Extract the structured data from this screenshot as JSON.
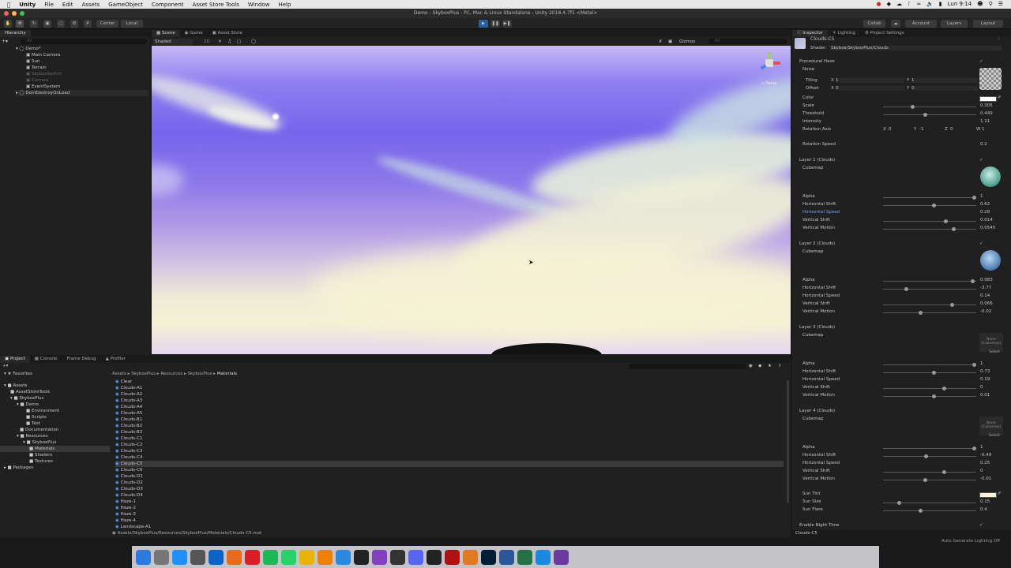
{
  "menubar": {
    "app": "Unity",
    "items": [
      "File",
      "Edit",
      "Assets",
      "GameObject",
      "Component",
      "Asset Store Tools",
      "Window",
      "Help"
    ],
    "clock": "Lun 9:14"
  },
  "window_title": "Demo - SkyboxPlus - PC, Mac & Linux Standalone - Unity 2018.4.7f1 <Metal>",
  "toolbar": {
    "center": "Center",
    "local": "Local",
    "collab": "Collab",
    "account": "Account",
    "layers": "Layers",
    "layout": "Layout"
  },
  "hierarchy": {
    "tab": "Hierarchy",
    "search_placeholder": "All",
    "scene_name": "Demo*",
    "items": [
      "Main Camera",
      "Sun",
      "Terrain",
      "SkyboxSwitch",
      "Camera",
      "EventSystem"
    ],
    "dont_destroy": "DontDestroyOnLoad"
  },
  "scene_view": {
    "tabs": [
      "Scene",
      "Game",
      "Asset Store"
    ],
    "shading": "Shaded",
    "mode": "2D",
    "gizmos": "Gizmos",
    "search_placeholder": "All",
    "persp": "< Persp"
  },
  "project": {
    "tabs": [
      "Project",
      "Console",
      "Frame Debug",
      "Profiler"
    ],
    "favorites": "Favorites",
    "assets": "Assets",
    "tree": [
      "AssetStoreTools",
      "SkyboxPlus",
      "Demo",
      "Environment",
      "Scripts",
      "Test",
      "Documentation",
      "Resources",
      "SkyboxPlus",
      "Materials",
      "Shaders",
      "Textures"
    ],
    "packages": "Packages",
    "breadcrumb": [
      "Assets",
      "SkyboxPlus",
      "Resources",
      "SkyboxPlus",
      "Materials"
    ],
    "files": [
      "Clear",
      "Clouds-A1",
      "Clouds-A2",
      "Clouds-A3",
      "Clouds-A4",
      "Clouds-A5",
      "Clouds-B1",
      "Clouds-B2",
      "Clouds-B3",
      "Clouds-C1",
      "Clouds-C2",
      "Clouds-C3",
      "Clouds-C4",
      "Clouds-C5",
      "Clouds-C6",
      "Clouds-D1",
      "Clouds-D2",
      "Clouds-D3",
      "Clouds-D4",
      "Haze-1",
      "Haze-2",
      "Haze-3",
      "Haze-4",
      "Landscape-A1"
    ],
    "selected_index": 13,
    "path": "Assets/SkyboxPlus/Resources/SkyboxPlus/Materials/Clouds-C5.mat"
  },
  "inspector": {
    "tabs": [
      "Inspector",
      "Lighting",
      "Project Settings"
    ],
    "material_name": "Clouds-C5",
    "shader_label": "Shader",
    "shader_value": "Skybox/SkyboxPlus/Clouds",
    "procedural_haze": "Procedural Haze",
    "noise": "Noise",
    "tiling_label": "Tiling",
    "tiling": [
      "X",
      "1",
      "Y",
      "1"
    ],
    "offset_label": "Offset",
    "offset": [
      "X",
      "0",
      "Y",
      "0"
    ],
    "color_label": "Color",
    "haze_props": [
      {
        "label": "Scale",
        "value": "0.305",
        "pos": 0.31
      },
      {
        "label": "Threshold",
        "value": "0.449",
        "pos": 0.45
      },
      {
        "label": "Intensity",
        "value": "1.11",
        "pos": null
      }
    ],
    "rotation_axis_label": "Rotation Axis",
    "rotation_axis": [
      "X",
      "0",
      "Y",
      "-1",
      "Z",
      "0",
      "W",
      "1"
    ],
    "rotation_speed_label": "Rotation Speed",
    "rotation_speed": "0.2",
    "cubemap_label": "Cubemap",
    "none_cubemap": "None\n(Cubemap)",
    "select": "Select",
    "layers": [
      {
        "title": "Layer 1 (Clouds)",
        "props": [
          {
            "label": "Alpha",
            "value": "1",
            "pos": 1.0
          },
          {
            "label": "Horizontal Shift",
            "value": "0.62",
            "pos": 0.55
          },
          {
            "label": "Horizontal Speed",
            "value": "0.28",
            "pos": null,
            "highlight": true
          },
          {
            "label": "Vertical Shift",
            "value": "0.014",
            "pos": 0.68
          },
          {
            "label": "Vertical Motion",
            "value": "0.0545",
            "pos": 0.77
          }
        ]
      },
      {
        "title": "Layer 2 (Clouds)",
        "props": [
          {
            "label": "Alpha",
            "value": "0.983",
            "pos": 0.98
          },
          {
            "label": "Horizontal Shift",
            "value": "-3.77",
            "pos": 0.24
          },
          {
            "label": "Horizontal Speed",
            "value": "0.14",
            "pos": null
          },
          {
            "label": "Vertical Shift",
            "value": "0.066",
            "pos": 0.75
          },
          {
            "label": "Vertical Motion",
            "value": "-0.02",
            "pos": 0.4
          }
        ]
      },
      {
        "title": "Layer 3 (Clouds)",
        "props": [
          {
            "label": "Alpha",
            "value": "1",
            "pos": 1.0
          },
          {
            "label": "Horizontal Shift",
            "value": "0.73",
            "pos": 0.55
          },
          {
            "label": "Horizontal Speed",
            "value": "0.19",
            "pos": null
          },
          {
            "label": "Vertical Shift",
            "value": "0",
            "pos": 0.66
          },
          {
            "label": "Vertical Motion",
            "value": "0.01",
            "pos": 0.55
          }
        ]
      },
      {
        "title": "Layer 4 (Clouds)",
        "props": [
          {
            "label": "Alpha",
            "value": "1",
            "pos": 1.0
          },
          {
            "label": "Horizontal Shift",
            "value": "-0.49",
            "pos": 0.46
          },
          {
            "label": "Horizontal Speed",
            "value": "0.25",
            "pos": null
          },
          {
            "label": "Vertical Shift",
            "value": "0",
            "pos": 0.66
          },
          {
            "label": "Vertical Motion",
            "value": "-0.01",
            "pos": 0.45
          }
        ]
      }
    ],
    "sun_props": [
      {
        "label": "Sun Tint",
        "value": "",
        "pos": null
      },
      {
        "label": "Sun Size",
        "value": "0.15",
        "pos": 0.16
      },
      {
        "label": "Sun Flare",
        "value": "0.4",
        "pos": 0.4
      }
    ],
    "enable_night_time": "Enable Night Time",
    "footer_name": "Clouds-C5"
  },
  "status_bar": "Auto Generate Lighting Off",
  "dock": [
    "Finder",
    "Prefs",
    "AppStore",
    "Launchpad",
    "Outlook",
    "Firefox",
    "Opera",
    "Spotify",
    "WhatsApp",
    "Chrome",
    "VLC",
    "Maps",
    "Unity",
    "Affinity",
    "GitHub",
    "Discord",
    "Epic",
    "FileZilla",
    "Sublime",
    "Ps",
    "Word",
    "Excel",
    "Safari",
    "VS"
  ],
  "colors": {
    "accent_blue": "#2d5d96",
    "highlight_text": "#6fa3ff",
    "sky_top": "#7764ec",
    "sky_horizon": "#f5f1d5"
  }
}
